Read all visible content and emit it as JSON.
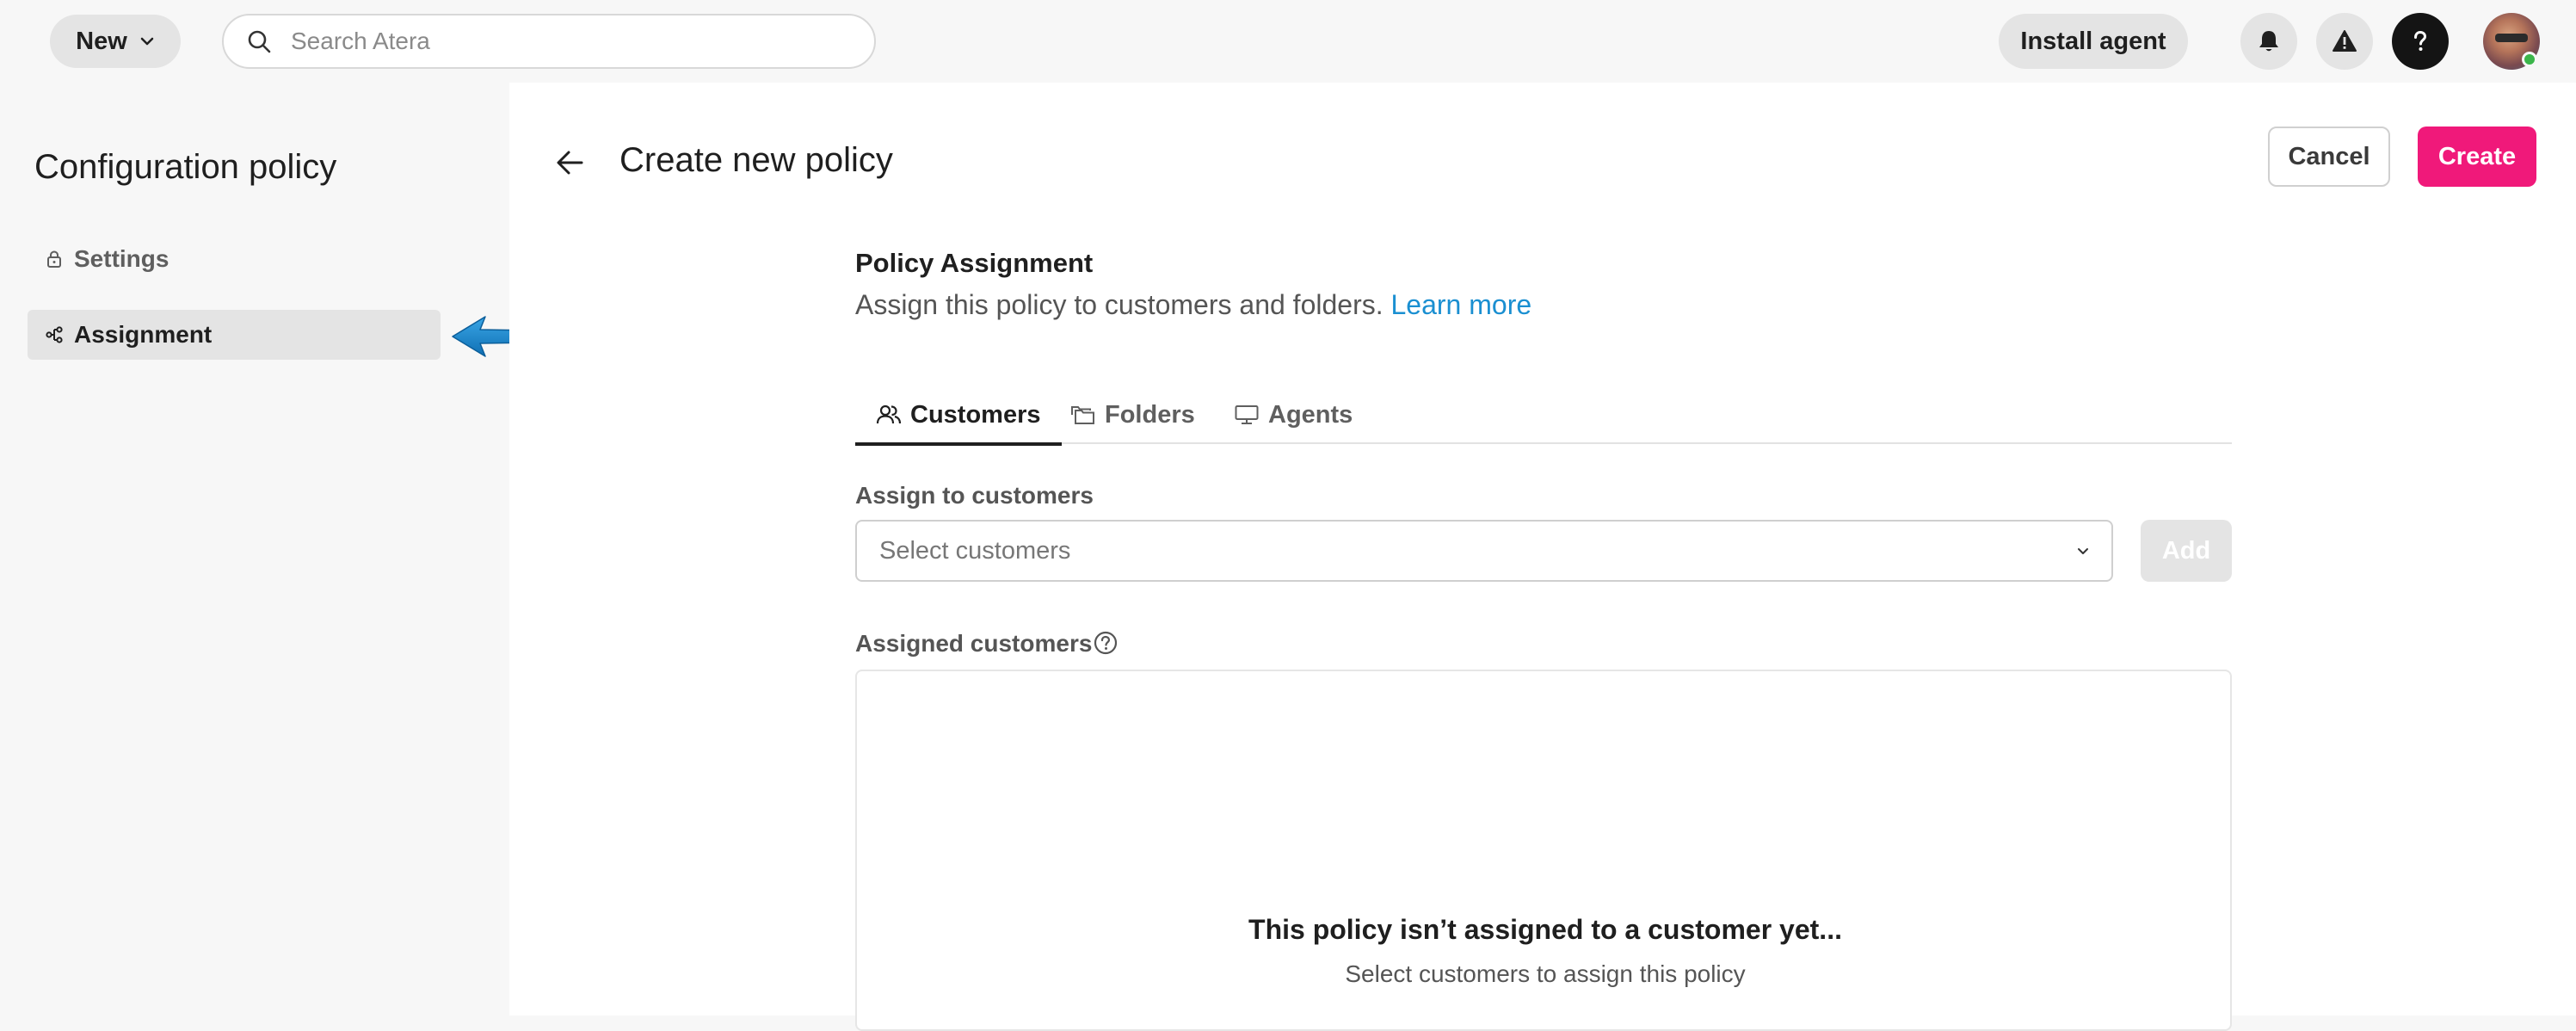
{
  "topbar": {
    "new_label": "New",
    "search_placeholder": "Search Atera",
    "install_agent_label": "Install agent"
  },
  "sidebar": {
    "title": "Configuration policy",
    "items": [
      {
        "label": "Settings",
        "icon": "lock-icon",
        "active": false
      },
      {
        "label": "Assignment",
        "icon": "assignment-icon",
        "active": true
      }
    ]
  },
  "header": {
    "title": "Create new policy",
    "cancel_label": "Cancel",
    "create_label": "Create"
  },
  "assignment": {
    "title": "Policy Assignment",
    "subtitle": "Assign this policy to customers and folders.",
    "learn_more": "Learn more",
    "tabs": [
      {
        "label": "Customers",
        "icon": "users-icon",
        "active": true
      },
      {
        "label": "Folders",
        "icon": "folders-icon",
        "active": false
      },
      {
        "label": "Agents",
        "icon": "monitor-icon",
        "active": false
      }
    ],
    "assign_label": "Assign to customers",
    "select_placeholder": "Select customers",
    "add_label": "Add",
    "assigned_label": "Assigned customers",
    "empty_title": "This policy isn’t assigned to a customer yet...",
    "empty_subtitle": "Select customers to assign this policy"
  },
  "colors": {
    "accent_pink": "#f0197a",
    "link_blue": "#1a8fd1",
    "pointer_blue": "#1a7fc1"
  }
}
